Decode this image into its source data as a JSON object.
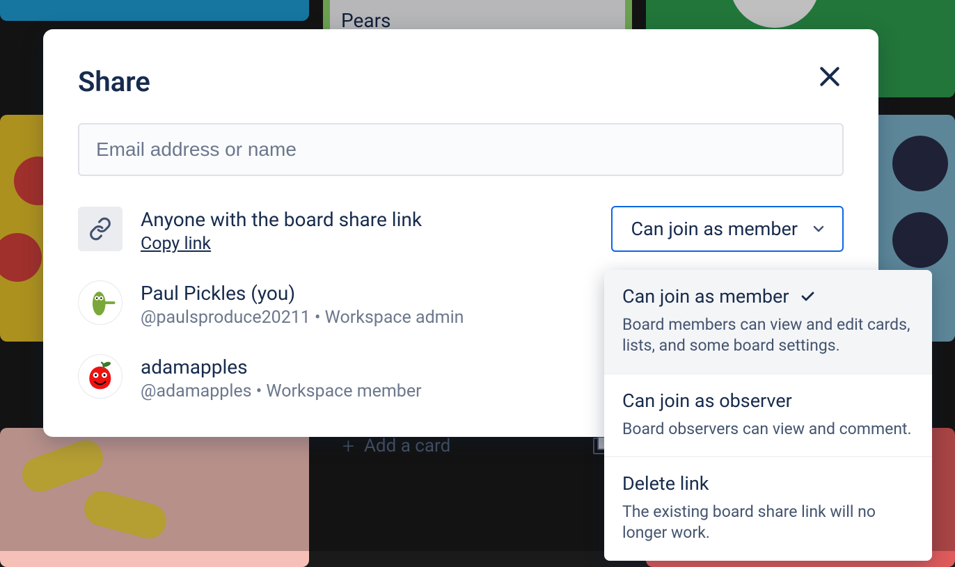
{
  "background": {
    "card_label": "Pears",
    "add_card_label": "Add a card"
  },
  "modal": {
    "title": "Share",
    "input_placeholder": "Email address or name",
    "share_link": {
      "title": "Anyone with the board share link",
      "copy_label": "Copy link"
    },
    "permission_selected": "Can join as member",
    "members": [
      {
        "name": "Paul Pickles (you)",
        "meta": "@paulsproduce20211 • Workspace admin"
      },
      {
        "name": "adamapples",
        "meta": "@adamapples • Workspace member"
      }
    ]
  },
  "dropdown": {
    "options": [
      {
        "title": "Can join as member",
        "desc": "Board members can view and edit cards, lists, and some board settings.",
        "selected": true
      },
      {
        "title": "Can join as observer",
        "desc": "Board observers can view and comment.",
        "selected": false
      },
      {
        "title": "Delete link",
        "desc": "The existing board share link will no longer work.",
        "selected": false
      }
    ]
  }
}
